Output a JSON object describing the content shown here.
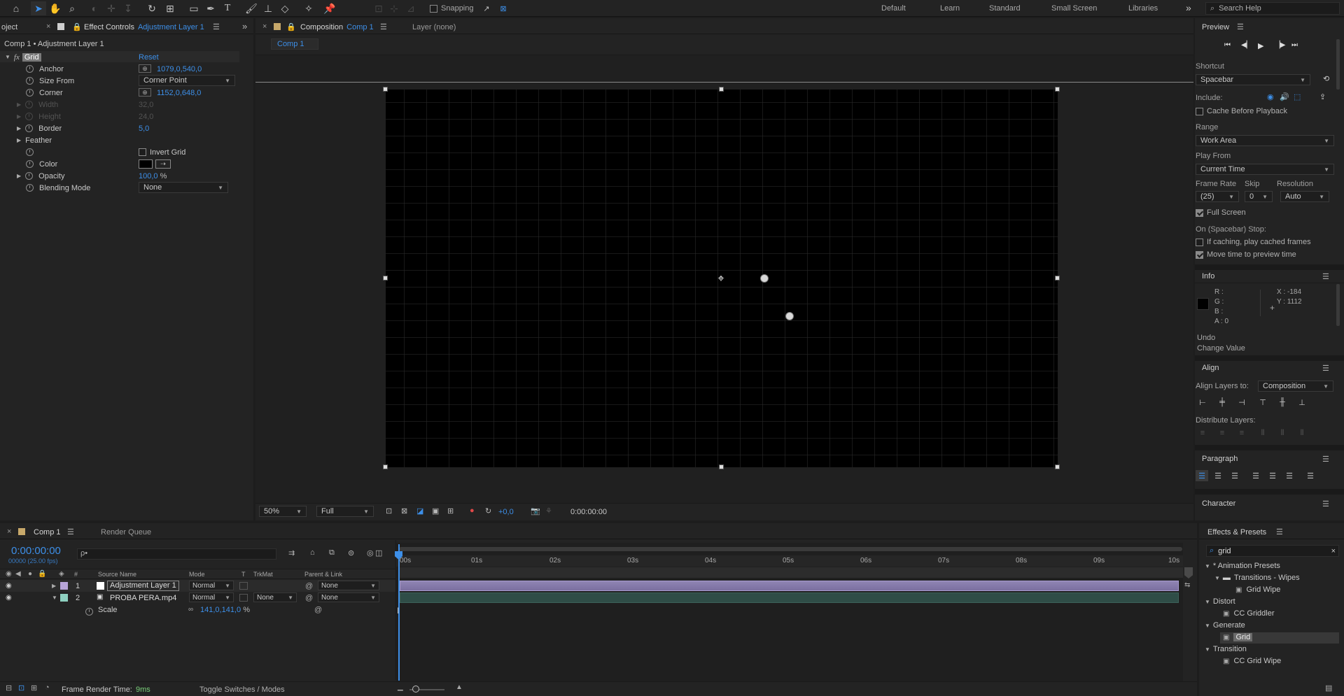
{
  "toolbar": {
    "snapping_label": "Snapping",
    "workspaces": [
      "Default",
      "Learn",
      "Standard",
      "Small Screen",
      "Libraries"
    ],
    "search_placeholder": "Search Help"
  },
  "effect_controls": {
    "left_tab": "oject",
    "tab_label": "Effect Controls",
    "tab_layer": "Adjustment Layer 1",
    "subtitle": "Comp 1 • Adjustment Layer 1",
    "effect_name": "Grid",
    "reset_label": "Reset",
    "props": [
      {
        "name": "Anchor",
        "value": "1079,0,540,0"
      },
      {
        "name": "Size From",
        "value": "Corner Point"
      },
      {
        "name": "Corner",
        "value": "1152,0,648,0"
      },
      {
        "name": "Width",
        "value": "32,0"
      },
      {
        "name": "Height",
        "value": "24,0"
      },
      {
        "name": "Border",
        "value": "5,0"
      },
      {
        "name": "Feather",
        "value": ""
      },
      {
        "name": "Invert Grid",
        "value": ""
      },
      {
        "name": "Color",
        "value": ""
      },
      {
        "name": "Opacity",
        "value": "100,0",
        "unit": "%"
      },
      {
        "name": "Blending Mode",
        "value": "None"
      }
    ]
  },
  "composition": {
    "tab_label": "Composition",
    "tab_comp": "Comp 1",
    "layer_tab": "Layer (none)",
    "breadcrumb": "Comp 1",
    "zoom": "50%",
    "resolution": "Full",
    "exposure": "+0,0",
    "timecode": "0:00:00:00"
  },
  "preview": {
    "title": "Preview",
    "shortcut_label": "Shortcut",
    "shortcut_value": "Spacebar",
    "include_label": "Include:",
    "cache_label": "Cache Before Playback",
    "range_label": "Range",
    "range_value": "Work Area",
    "play_from_label": "Play From",
    "play_from_value": "Current Time",
    "frame_rate_label": "Frame Rate",
    "skip_label": "Skip",
    "resolution_label": "Resolution",
    "frame_rate_value": "(25)",
    "skip_value": "0",
    "resolution_value": "Auto",
    "full_screen_label": "Full Screen",
    "stop_label": "On (Spacebar) Stop:",
    "if_caching_label": "If caching, play cached frames",
    "move_time_label": "Move time to preview time"
  },
  "info": {
    "title": "Info",
    "r": "R :",
    "g": "G :",
    "b": "B :",
    "a": "A :  0",
    "x": "X : -184",
    "y": "Y : 1112",
    "undo": "Undo",
    "change": "Change Value"
  },
  "align": {
    "title": "Align",
    "align_to_label": "Align Layers to:",
    "align_to_value": "Composition",
    "distribute_label": "Distribute Layers:"
  },
  "paragraph": {
    "title": "Paragraph"
  },
  "character": {
    "title": "Character"
  },
  "timeline": {
    "tab_comp": "Comp 1",
    "render_queue": "Render Queue",
    "timecode": "0:00:00:00",
    "fps": "00000 (25.00 fps)",
    "search_placeholder": "ρ•",
    "col_source": "Source Name",
    "col_mode": "Mode",
    "col_t": "T",
    "col_trkmat": "TrkMat",
    "col_parent": "Parent & Link",
    "col_hash": "#",
    "ruler": [
      "00s",
      "01s",
      "02s",
      "03s",
      "04s",
      "05s",
      "06s",
      "07s",
      "08s",
      "09s",
      "10s"
    ],
    "layers": [
      {
        "num": "1",
        "name": "Adjustment Layer 1",
        "mode": "Normal",
        "trkmat": "",
        "parent": "None"
      },
      {
        "num": "2",
        "name": "PROBA PERA.mp4",
        "mode": "Normal",
        "trkmat": "None",
        "parent": "None"
      }
    ],
    "scale_label": "Scale",
    "scale_value": "141,0,141,0",
    "scale_unit": "%",
    "frame_render_label": "Frame Render Time:",
    "frame_render_value": "9ms",
    "toggle_label": "Toggle Switches / Modes"
  },
  "effects_presets": {
    "title": "Effects & Presets",
    "search_value": "grid",
    "tree": [
      {
        "label": "* Animation Presets",
        "level": 0
      },
      {
        "label": "Transitions - Wipes",
        "level": 1
      },
      {
        "label": "Grid Wipe",
        "level": 2
      },
      {
        "label": "Distort",
        "level": 0
      },
      {
        "label": "CC Griddler",
        "level": 2
      },
      {
        "label": "Generate",
        "level": 0
      },
      {
        "label": "Grid",
        "level": 2
      },
      {
        "label": "Transition",
        "level": 0
      },
      {
        "label": "CC Grid Wipe",
        "level": 2
      }
    ]
  }
}
